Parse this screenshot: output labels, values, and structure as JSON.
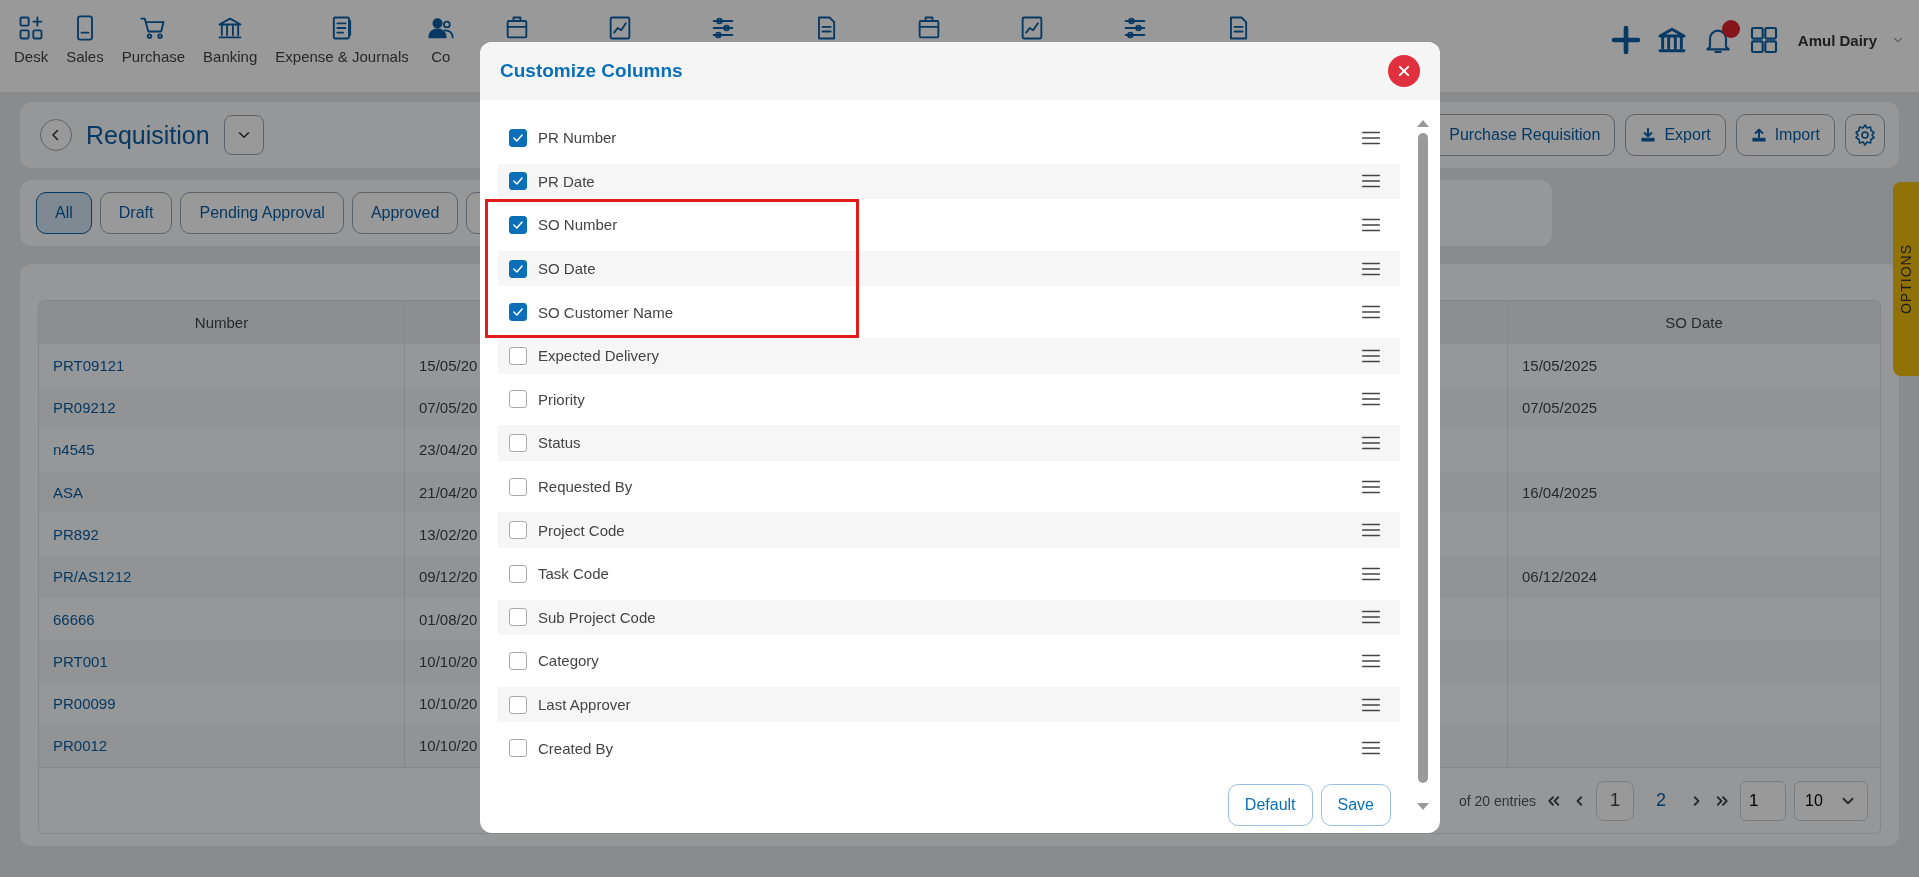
{
  "nav": {
    "items": [
      {
        "label": "Desk"
      },
      {
        "label": "Sales"
      },
      {
        "label": "Purchase"
      },
      {
        "label": "Banking"
      },
      {
        "label": "Expense & Journals"
      },
      {
        "label": "Co"
      }
    ],
    "user": "Amul Dairy",
    "notification_dot": true
  },
  "page": {
    "title": "Requisition",
    "actions": [
      {
        "label": "Purchase Requisition"
      },
      {
        "label": "Export"
      },
      {
        "label": "Import"
      }
    ]
  },
  "filters": [
    {
      "label": "All",
      "selected": true
    },
    {
      "label": "Draft",
      "selected": false
    },
    {
      "label": "Pending Approval",
      "selected": false
    },
    {
      "label": "Approved",
      "selected": false
    }
  ],
  "table": {
    "columns": [
      "Number",
      "SO Date"
    ],
    "rows": [
      {
        "number": "PRT09121",
        "column_2": "15/05/20",
        "so_date": "15/05/2025"
      },
      {
        "number": "PR09212",
        "column_2": "07/05/20",
        "so_date": "07/05/2025"
      },
      {
        "number": "n4545",
        "column_2": "23/04/20",
        "so_date": ""
      },
      {
        "number": "ASA",
        "column_2": "21/04/20",
        "so_date": "16/04/2025"
      },
      {
        "number": "PR892",
        "column_2": "13/02/20",
        "so_date": ""
      },
      {
        "number": "PR/AS1212",
        "column_2": "09/12/20",
        "so_date": "06/12/2024"
      },
      {
        "number": "66666",
        "column_2": "01/08/20",
        "so_date": ""
      },
      {
        "number": "PRT001",
        "column_2": "10/10/20",
        "so_date": ""
      },
      {
        "number": "PR00099",
        "column_2": "10/10/20",
        "so_date": ""
      },
      {
        "number": "PR0012",
        "column_2": "10/10/20",
        "so_date": ""
      }
    ]
  },
  "pagination": {
    "info": "of 20 entries",
    "pages": [
      {
        "label": "1",
        "selected": true
      },
      {
        "label": "2",
        "selected": false
      }
    ],
    "page_input": "1",
    "page_size": "10"
  },
  "options_tab": "OPTIONS",
  "dialog": {
    "title": "Customize Columns",
    "columns": [
      {
        "label": "PR Number",
        "checked": true,
        "highlighted": false
      },
      {
        "label": "PR Date",
        "checked": true,
        "highlighted": false
      },
      {
        "label": "SO Number",
        "checked": true,
        "highlighted": true
      },
      {
        "label": "SO Date",
        "checked": true,
        "highlighted": true
      },
      {
        "label": "SO Customer Name",
        "checked": true,
        "highlighted": true
      },
      {
        "label": "Expected Delivery",
        "checked": false,
        "highlighted": false
      },
      {
        "label": "Priority",
        "checked": false,
        "highlighted": false
      },
      {
        "label": "Status",
        "checked": false,
        "highlighted": false
      },
      {
        "label": "Requested By",
        "checked": false,
        "highlighted": false
      },
      {
        "label": "Project Code",
        "checked": false,
        "highlighted": false
      },
      {
        "label": "Task Code",
        "checked": false,
        "highlighted": false
      },
      {
        "label": "Sub Project Code",
        "checked": false,
        "highlighted": false
      },
      {
        "label": "Category",
        "checked": false,
        "highlighted": false
      },
      {
        "label": "Last Approver",
        "checked": false,
        "highlighted": false
      },
      {
        "label": "Created By",
        "checked": false,
        "highlighted": false
      }
    ],
    "buttons": [
      "Default",
      "Save"
    ]
  }
}
